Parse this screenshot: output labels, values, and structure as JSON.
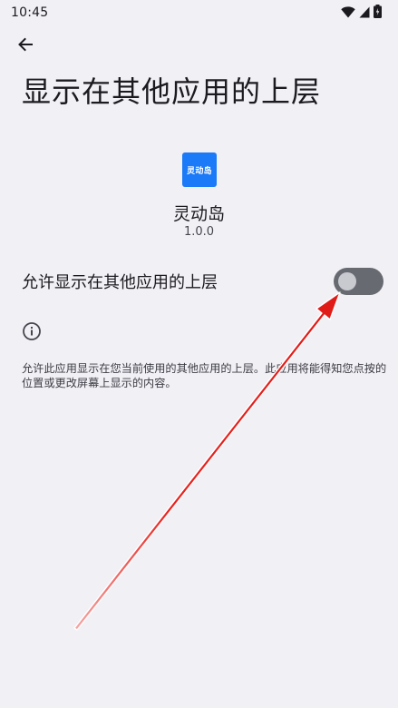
{
  "status_bar": {
    "time": "10:45",
    "icons": [
      "wifi-icon",
      "signal-icon",
      "battery-icon"
    ]
  },
  "header": {
    "back_icon": "arrow-left-icon",
    "title": "显示在其他应用的上层"
  },
  "app": {
    "icon_text": "灵动岛",
    "name": "灵动岛",
    "version": "1.0.0",
    "icon_color": "#1a7af8"
  },
  "setting": {
    "label": "允许显示在其他应用的上层",
    "enabled": false
  },
  "info": {
    "icon": "info-icon",
    "text": "允许此应用显示在您当前使用的其他应用的上层。此应用将能得知您点按的位置或更改屏幕上显示的内容。"
  },
  "annotation": {
    "arrow_color": "#e8231f"
  }
}
